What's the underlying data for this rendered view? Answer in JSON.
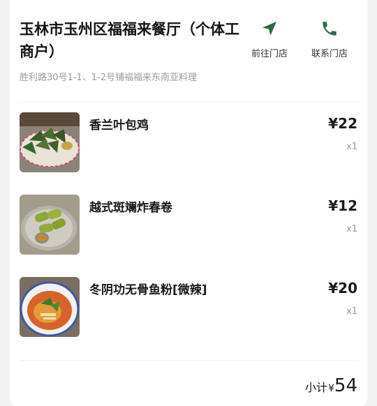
{
  "store": {
    "name": "玉林市玉州区福福来餐厅（个体工商户）",
    "address": "胜利路30号1-1、1-2号铺福福来东南亚料理"
  },
  "actions": {
    "navigate_label": "前往门店",
    "navigate_icon": "navigation-arrow-icon",
    "contact_label": "联系门店",
    "contact_icon": "phone-icon"
  },
  "items": [
    {
      "name": "香兰叶包鸡",
      "price": "¥22",
      "qty": "x1"
    },
    {
      "name": "越式斑斓炸春卷",
      "price": "¥12",
      "qty": "x1"
    },
    {
      "name": "冬阴功无骨鱼粉[微辣]",
      "price": "¥20",
      "qty": "x1"
    }
  ],
  "subtotal": {
    "label": "小计",
    "currency": "¥",
    "amount": "54"
  },
  "colors": {
    "accent": "#2e6b45",
    "background": "#f2f2f2",
    "card": "#ffffff"
  }
}
